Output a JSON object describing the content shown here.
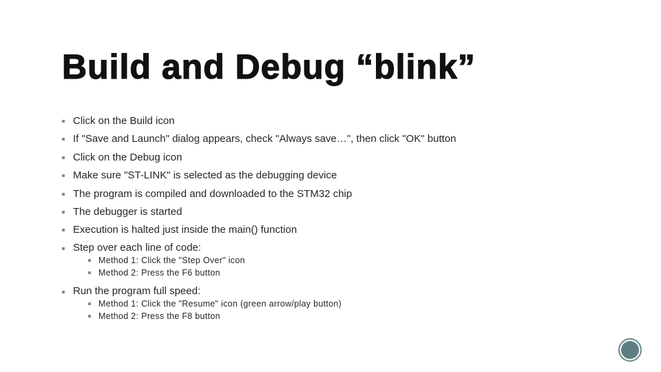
{
  "slide": {
    "title": "Build and Debug “blink”",
    "bullets": [
      {
        "text": "Click on the Build icon"
      },
      {
        "text": "If \"Save and Launch\" dialog appears, check \"Always save…\", then click \"OK\" button"
      },
      {
        "text": "Click on the Debug icon"
      },
      {
        "text": "Make sure \"ST-LINK\" is selected as the debugging device"
      },
      {
        "text": "The program is compiled and downloaded to the STM32 chip"
      },
      {
        "text": "The debugger is started"
      },
      {
        "text": "Execution is halted just inside the main() function"
      },
      {
        "text": "Step over each line of code:",
        "sub": [
          "Method 1:  Click the \"Step Over\" icon",
          "Method 2:  Press the F6 button"
        ]
      },
      {
        "text": "Run the program full speed:",
        "sub": [
          "Method 1:  Click the \"Resume\" icon (green arrow/play button)",
          "Method 2:  Press the F8 button"
        ]
      }
    ]
  },
  "nav": {
    "icon": "circle-nav-icon",
    "color": "#5e7f82"
  }
}
